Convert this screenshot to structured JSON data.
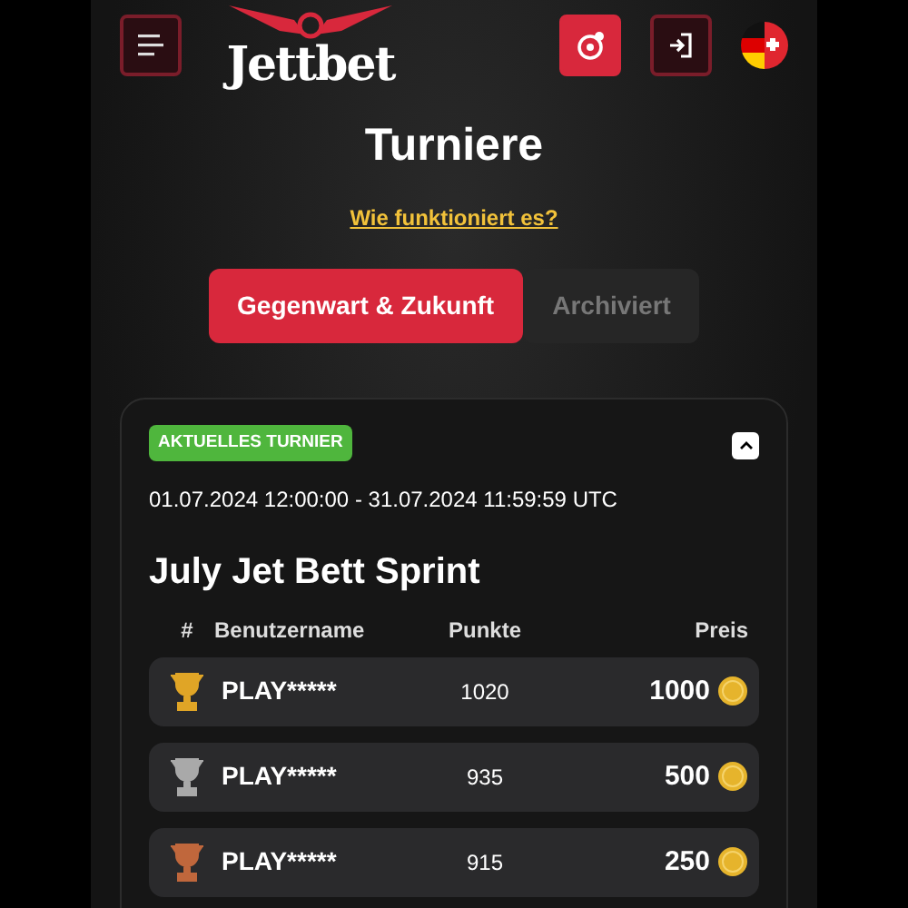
{
  "header": {
    "logo": "Jettbet"
  },
  "page_title": "Turniere",
  "help_link": "Wie funktioniert es?",
  "tabs": [
    {
      "label": "Gegenwart & Zukunft",
      "selected": true
    },
    {
      "label": "Archiviert",
      "selected": false
    }
  ],
  "tournament": {
    "badge": "AKTUELLES TURNIER",
    "expanded": true,
    "period": "01.07.2024 12:00:00 - 31.07.2024 11:59:59 UTC",
    "name": "July Jet Bett Sprint",
    "columns": [
      "#",
      "Benutzername",
      "Punkte",
      "Preis"
    ],
    "rows": [
      {
        "color": "#e0a526",
        "user": "PLAY*****",
        "points": "1020",
        "prize": "1000"
      },
      {
        "color": "#a9a9a9",
        "user": "PLAY*****",
        "points": "935",
        "prize": "500"
      },
      {
        "color": "#c0673c",
        "user": "PLAY*****",
        "points": "915",
        "prize": "250"
      }
    ]
  }
}
